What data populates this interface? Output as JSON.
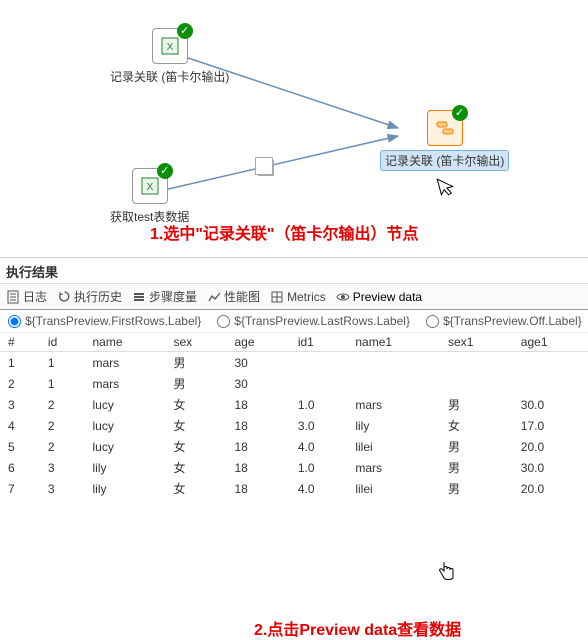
{
  "colors": {
    "accent_red": "#e60000",
    "success": "#0a8f08",
    "link": "#0066cc",
    "selected_bg": "#d0e4f5"
  },
  "canvas": {
    "nodes": {
      "n1": {
        "label": "记录关联 (笛卡尔输出)"
      },
      "n2": {
        "label": "获取test表数据"
      },
      "n3": {
        "label": "记录关联 (笛卡尔输出)"
      }
    },
    "annotation1": "1.选中\"记录关联\"（笛卡尔输出）节点"
  },
  "panel": {
    "title": "执行结果",
    "tabs": {
      "log": {
        "label": "日志",
        "icon": "doc-icon"
      },
      "history": {
        "label": "执行历史",
        "icon": "refresh-icon"
      },
      "stepmetrics": {
        "label": "步骤度量",
        "icon": "bars-icon"
      },
      "perf": {
        "label": "性能图",
        "icon": "chart-icon"
      },
      "metrics": {
        "label": "Metrics",
        "icon": "grid-icon"
      },
      "preview": {
        "label": "Preview data",
        "icon": "eye-icon"
      }
    },
    "annotation2": "2.点击Preview data查看数据",
    "radios": {
      "first": "${TransPreview.FirstRows.Label}",
      "last": "${TransPreview.LastRows.Label}",
      "off": "${TransPreview.Off.Label}"
    },
    "columns": [
      "#",
      "id",
      "name",
      "sex",
      "age",
      "id1",
      "name1",
      "sex1",
      "age1"
    ],
    "rows": [
      {
        "r": "1",
        "id": "1",
        "name": "mars",
        "sex": "男",
        "age": "30",
        "id1": "",
        "name1": "",
        "sex1": "",
        "age1": ""
      },
      {
        "r": "2",
        "id": "1",
        "name": "mars",
        "sex": "男",
        "age": "30",
        "id1": "",
        "name1": "",
        "sex1": "",
        "age1": ""
      },
      {
        "r": "3",
        "id": "2",
        "name": "lucy",
        "sex": "女",
        "age": "18",
        "id1": "1.0",
        "name1": "mars",
        "sex1": "男",
        "age1": "30.0"
      },
      {
        "r": "4",
        "id": "2",
        "name": "lucy",
        "sex": "女",
        "age": "18",
        "id1": "3.0",
        "name1": "lily",
        "sex1": "女",
        "age1": "17.0"
      },
      {
        "r": "5",
        "id": "2",
        "name": "lucy",
        "sex": "女",
        "age": "18",
        "id1": "4.0",
        "name1": "lilei",
        "sex1": "男",
        "age1": "20.0"
      },
      {
        "r": "6",
        "id": "3",
        "name": "lily",
        "sex": "女",
        "age": "18",
        "id1": "1.0",
        "name1": "mars",
        "sex1": "男",
        "age1": "30.0"
      },
      {
        "r": "7",
        "id": "3",
        "name": "lily",
        "sex": "女",
        "age": "18",
        "id1": "4.0",
        "name1": "lilei",
        "sex1": "男",
        "age1": "20.0"
      }
    ]
  }
}
